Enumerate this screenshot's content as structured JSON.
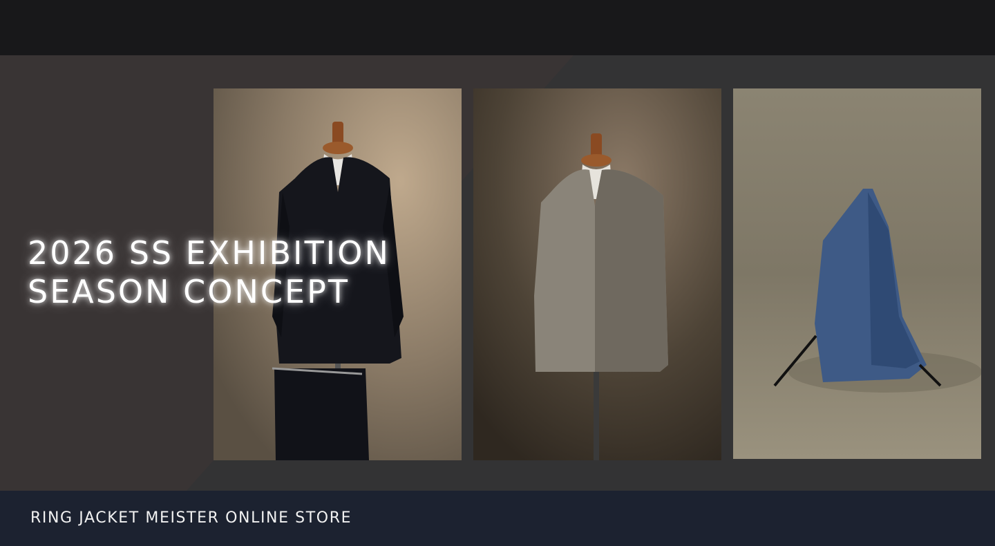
{
  "hero": {
    "headline_line1": "2026 SS EXHIBITION",
    "headline_line2": "SEASON CONCEPT",
    "photos": [
      {
        "subject": "navy double-breasted jacket and trousers on mannequin"
      },
      {
        "subject": "grey single-breasted jacket on mannequin"
      },
      {
        "subject": "blue linen jacket on stand"
      }
    ]
  },
  "footer": {
    "store_name": "RING JACKET MEISTER ONLINE STORE"
  },
  "colors": {
    "topbar": "#18181a",
    "hero_dark": "#393434",
    "hero_light": "#333334",
    "footer": "#1c2230",
    "text": "#ffffff"
  }
}
